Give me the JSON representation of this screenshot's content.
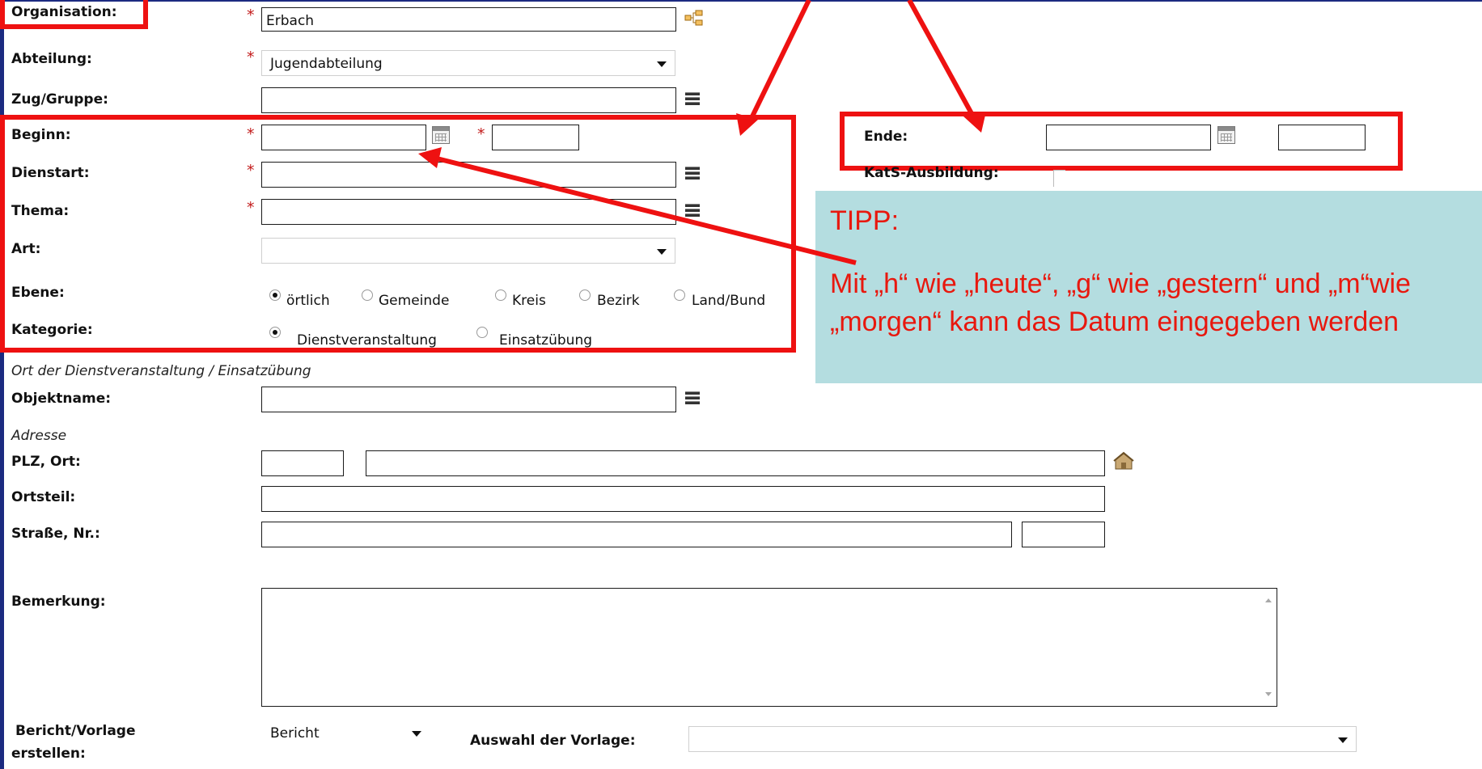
{
  "form": {
    "organisation": {
      "label": "Organisation:",
      "value": "Erbach"
    },
    "abteilung": {
      "label": "Abteilung:",
      "value": "Jugendabteilung"
    },
    "zug_gruppe": {
      "label": "Zug/Gruppe:",
      "value": ""
    },
    "beginn": {
      "label": "Beginn:",
      "date": "",
      "time": ""
    },
    "dienstart": {
      "label": "Dienstart:",
      "value": ""
    },
    "thema": {
      "label": "Thema:",
      "value": ""
    },
    "art": {
      "label": "Art:",
      "value": ""
    },
    "ebene": {
      "label": "Ebene:",
      "options": [
        "örtlich",
        "Gemeinde",
        "Kreis",
        "Bezirk",
        "Land/Bund"
      ],
      "selected": "örtlich"
    },
    "kategorie": {
      "label": "Kategorie:",
      "options": [
        "Dienstveranstaltung",
        "Einsatzübung"
      ],
      "selected": "Dienstveranstaltung"
    },
    "ort_section": "Ort der Dienstveranstaltung / Einsatzübung",
    "objektname": {
      "label": "Objektname:",
      "value": ""
    },
    "adresse_section": "Adresse",
    "plz_ort": {
      "label": "PLZ, Ort:",
      "plz": "",
      "ort": ""
    },
    "ortsteil": {
      "label": "Ortsteil:",
      "value": ""
    },
    "strasse_nr": {
      "label": "Straße, Nr.:",
      "strasse": "",
      "nr": ""
    },
    "bemerkung": {
      "label": "Bemerkung:",
      "value": ""
    },
    "bericht": {
      "label_line1": "Bericht/Vorlage",
      "label_line2": "erstellen:",
      "value": "Bericht"
    },
    "vorlage": {
      "label": "Auswahl der Vorlage:",
      "value": ""
    },
    "ende": {
      "label": "Ende:",
      "date": "",
      "time": ""
    },
    "kats": {
      "label": "KatS-Ausbildung:"
    },
    "required_mark": "*"
  },
  "tipp": {
    "heading": "TIPP:",
    "text": "Mit „h“ wie „heute“, „g“ wie „gestern“ und „m“wie „morgen“ kann das Datum eingegeben werden"
  },
  "colors": {
    "annotation_red": "#ee1111",
    "tipp_bg": "#b4dde0",
    "tipp_text": "#e8180e",
    "frame": "#1b2a80"
  }
}
